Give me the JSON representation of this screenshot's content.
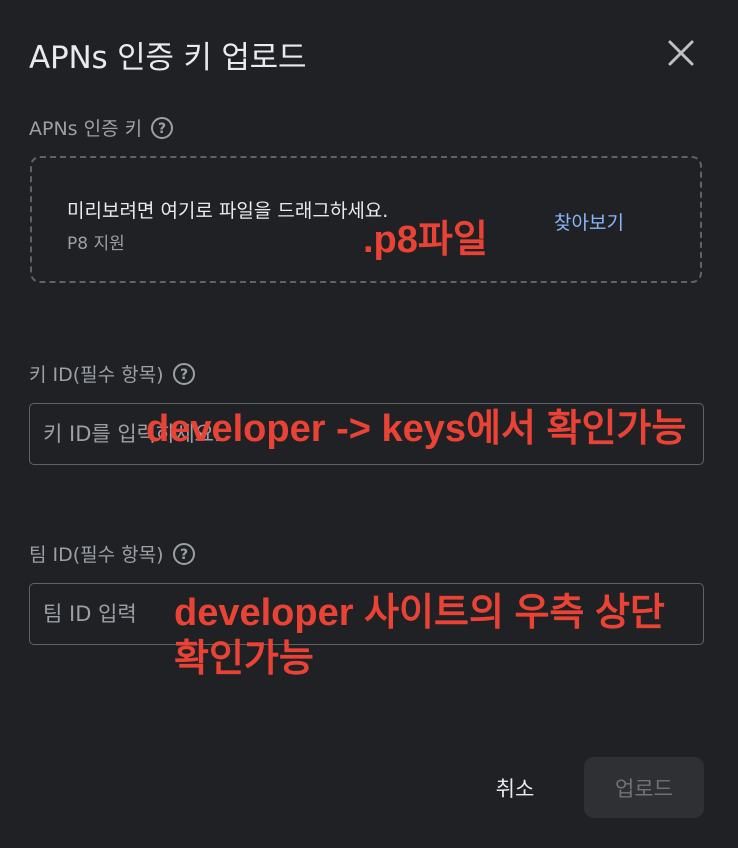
{
  "dialog": {
    "title": "APNs 인증 키 업로드",
    "close_icon": "close-icon"
  },
  "apns_key": {
    "label": "APNs 인증 키",
    "help_icon": "help-icon",
    "drop_text": "미리보려면 여기로 파일을 드래그하세요.",
    "support_text": "P8 지원",
    "browse_label": "찾아보기"
  },
  "key_id": {
    "label": "키 ID(필수 항목)",
    "help_icon": "help-icon",
    "placeholder": "키 ID를 입력하세요.",
    "value": ""
  },
  "team_id": {
    "label": "팀 ID(필수 항목)",
    "help_icon": "help-icon",
    "placeholder": "팀 ID 입력",
    "value": ""
  },
  "actions": {
    "cancel_label": "취소",
    "upload_label": "업로드"
  },
  "annotations": {
    "p8_note": ".p8파일",
    "key_note": "developer -> keys에서 확인가능",
    "team_note_line1": "developer 사이트의 우측 상단",
    "team_note_line2": "확인가능"
  },
  "colors": {
    "background": "#202124",
    "annotation": "#ea4335",
    "link": "#8ab4f8"
  }
}
